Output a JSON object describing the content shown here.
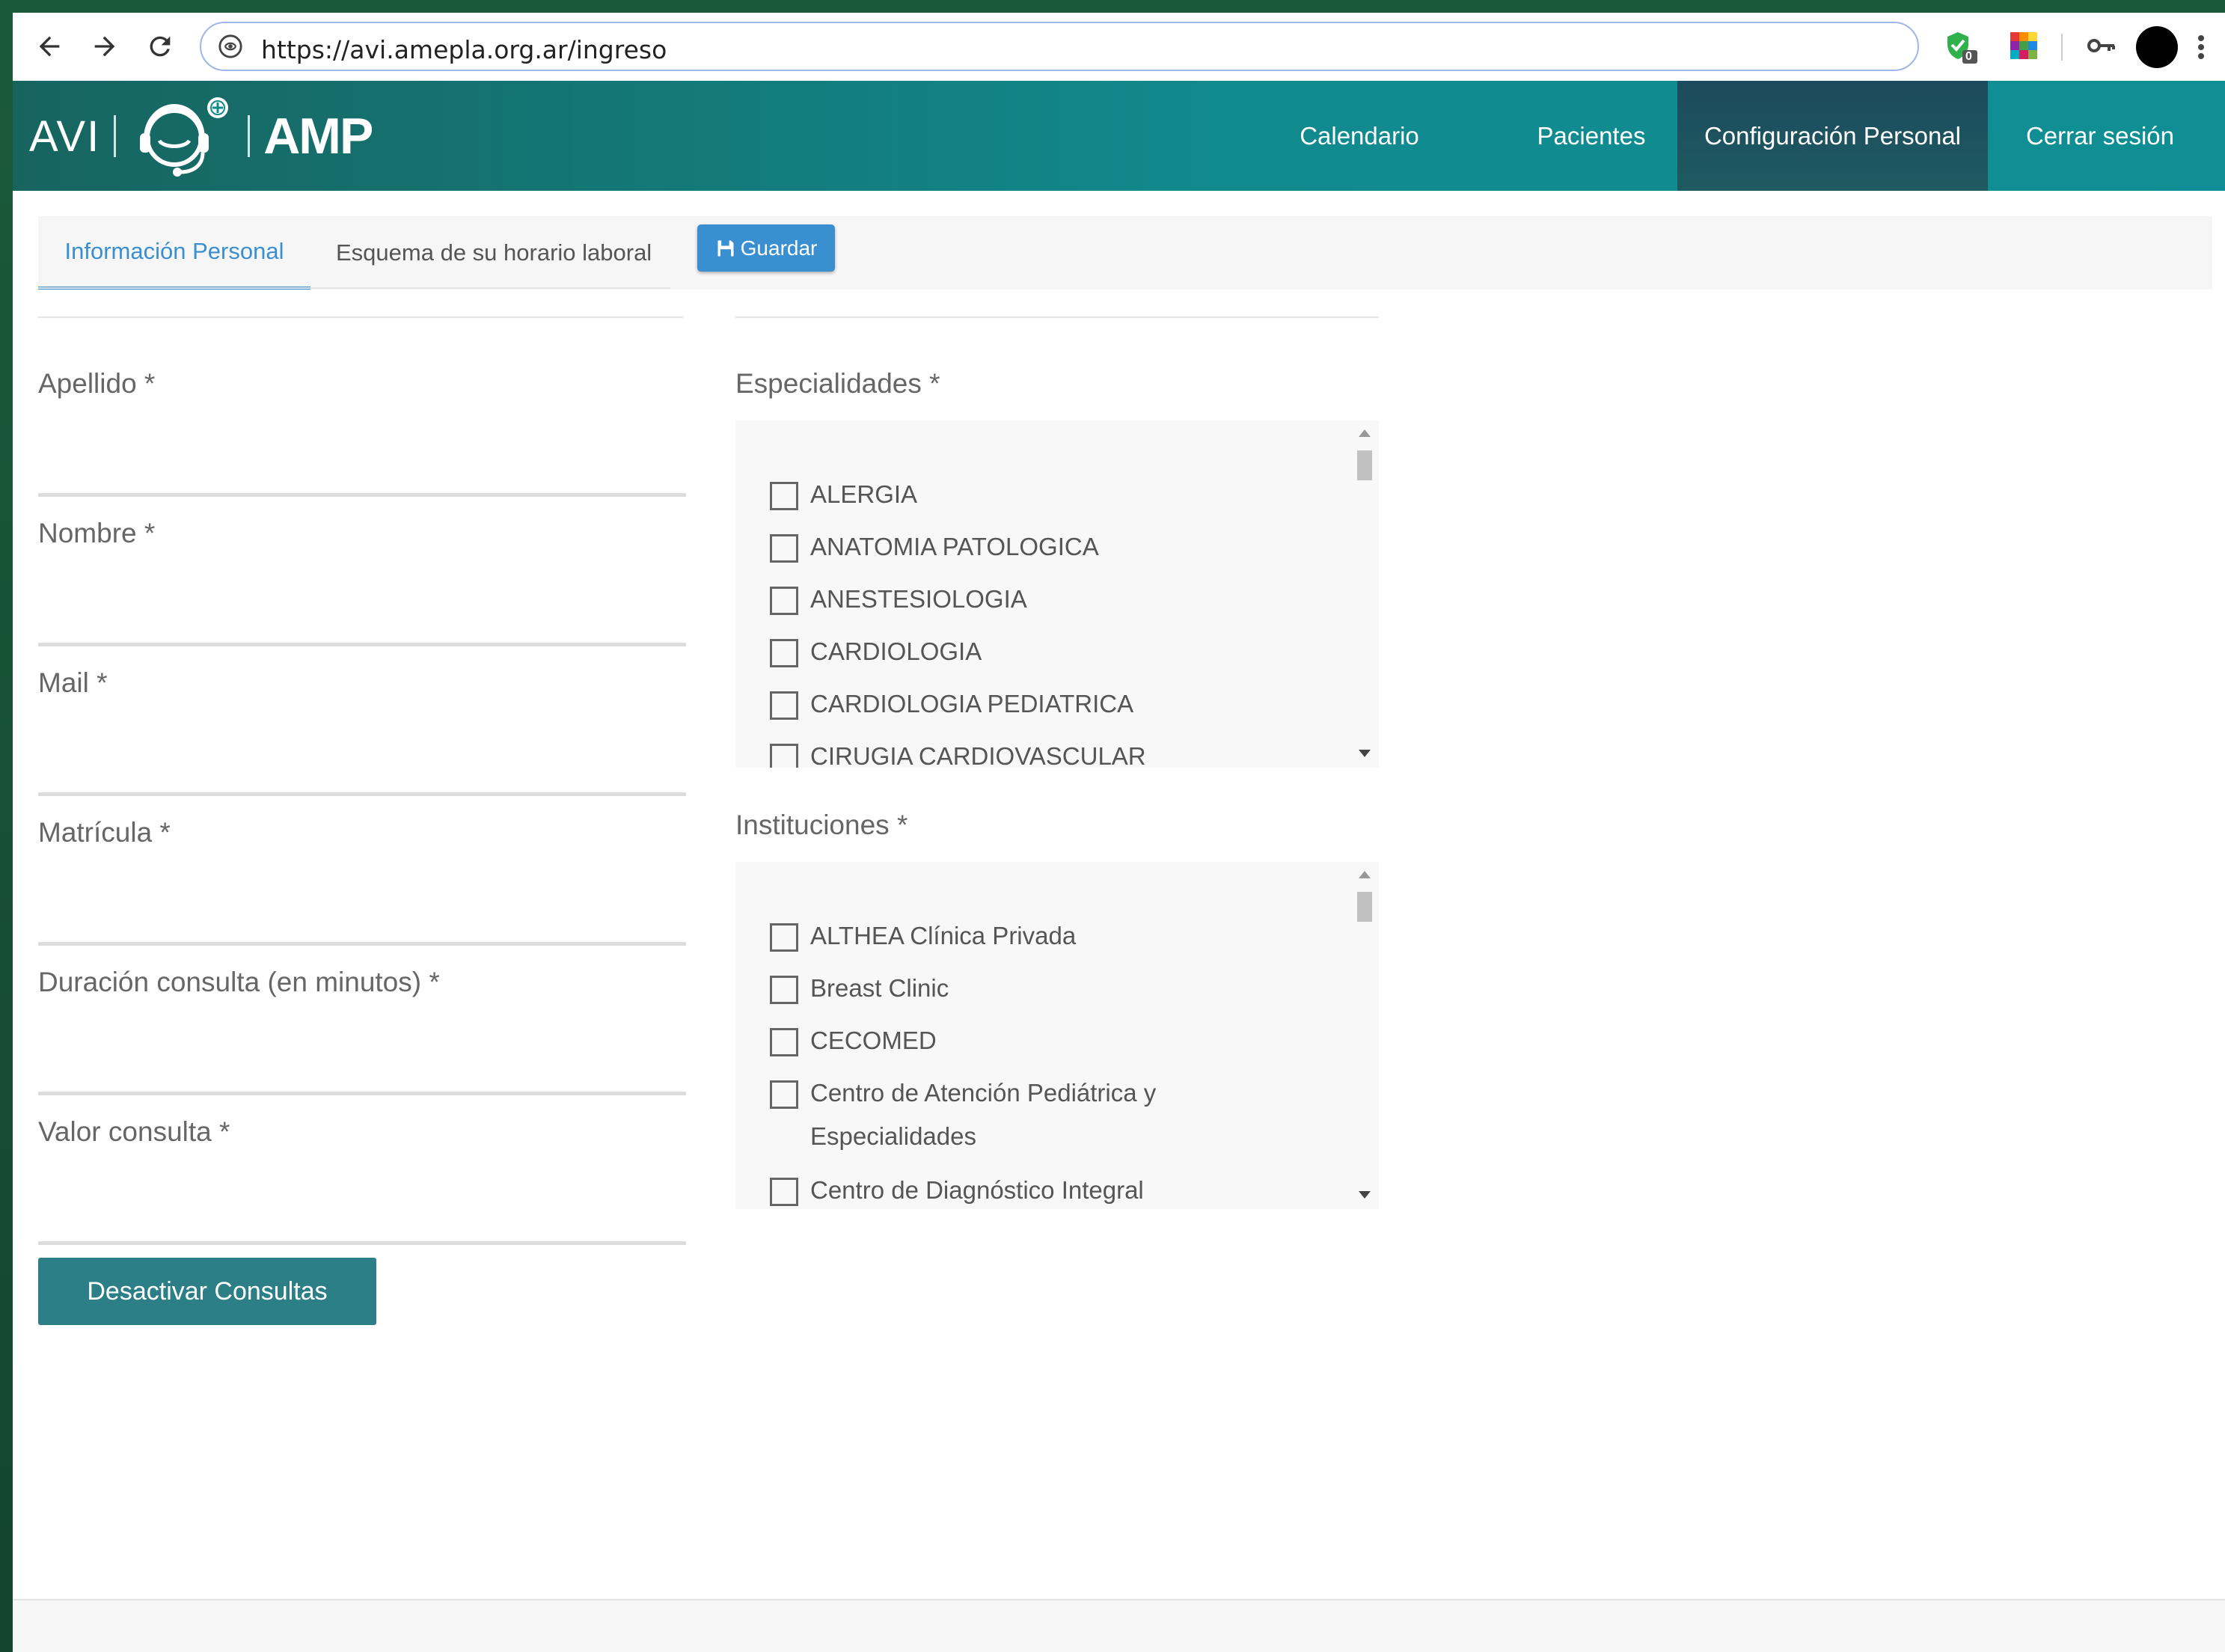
{
  "browser": {
    "url": "https://avi.amepla.org.ar/ingreso",
    "extension_badge": "0"
  },
  "brand": {
    "left": "AVI",
    "right": "AMP"
  },
  "nav": [
    {
      "label": "Calendario"
    },
    {
      "label": "Pacientes"
    },
    {
      "label": "Configuración Personal",
      "active": true
    },
    {
      "label": "Cerrar sesión"
    }
  ],
  "tabs": [
    {
      "label": "Información Personal",
      "active": true
    },
    {
      "label": "Esquema de su horario laboral"
    }
  ],
  "save_label": "Guardar",
  "fields": [
    {
      "label": "Apellido *"
    },
    {
      "label": "Nombre *"
    },
    {
      "label": "Mail *"
    },
    {
      "label": "Matrícula *"
    },
    {
      "label": "Duración consulta (en minutos) *"
    },
    {
      "label": "Valor consulta *"
    }
  ],
  "especialidades": {
    "label": "Especialidades *",
    "items": [
      "ALERGIA",
      "ANATOMIA PATOLOGICA",
      "ANESTESIOLOGIA",
      "CARDIOLOGIA",
      "CARDIOLOGIA PEDIATRICA",
      "CIRUGIA CARDIOVASCULAR"
    ]
  },
  "instituciones": {
    "label": "Instituciones *",
    "items": [
      "ALTHEA Clínica Privada",
      "Breast Clinic",
      "CECOMED",
      "Centro de Atención Pediátrica y Especialidades",
      "Centro de Diagnóstico Integral"
    ]
  },
  "deactivate_label": "Desactivar Consultas",
  "colors": {
    "header_teal": "#118a8e",
    "active_nav": "#1c4a5e",
    "primary_blue": "#3a8fd1",
    "deactivate_teal": "#2c7f86"
  }
}
